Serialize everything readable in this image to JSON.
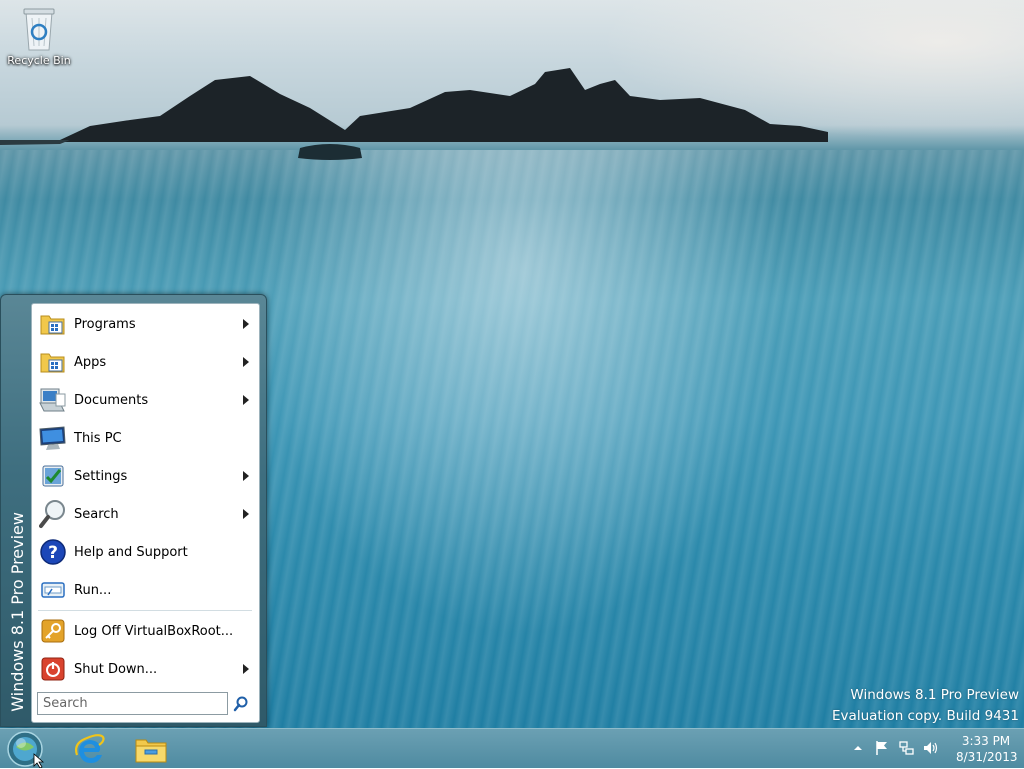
{
  "desktop": {
    "icons": [
      {
        "label": "Recycle Bin",
        "icon": "recycle-bin-icon"
      }
    ],
    "watermark": {
      "line1": "Windows 8.1 Pro Preview",
      "line2": "Evaluation copy. Build 9431"
    }
  },
  "start_menu": {
    "sidebar_label": "Windows 8.1 Pro Preview",
    "items": [
      {
        "label": "Programs",
        "icon": "programs-folder-icon",
        "submenu": true
      },
      {
        "label": "Apps",
        "icon": "apps-folder-icon",
        "submenu": true
      },
      {
        "label": "Documents",
        "icon": "documents-icon",
        "submenu": true
      },
      {
        "label": "This PC",
        "icon": "computer-icon",
        "submenu": false
      },
      {
        "label": "Settings",
        "icon": "settings-icon",
        "submenu": true
      },
      {
        "label": "Search",
        "icon": "magnifier-icon",
        "submenu": true
      },
      {
        "label": "Help and Support",
        "icon": "help-icon",
        "submenu": false
      },
      {
        "label": "Run...",
        "icon": "run-icon",
        "submenu": false
      },
      {
        "label": "Log Off VirtualBoxRoot...",
        "icon": "key-icon",
        "submenu": false
      },
      {
        "label": "Shut Down...",
        "icon": "power-icon",
        "submenu": true
      }
    ],
    "search": {
      "placeholder": "Search",
      "value": ""
    }
  },
  "taskbar": {
    "apps": [
      {
        "name": "Internet Explorer",
        "icon": "internet-explorer-icon"
      },
      {
        "name": "File Explorer",
        "icon": "file-explorer-icon"
      }
    ],
    "tray_icons": [
      "show-hidden-icons-arrow",
      "action-center-flag-icon",
      "network-icon",
      "volume-icon"
    ],
    "clock": {
      "time": "3:33 PM",
      "date": "8/31/2013"
    }
  }
}
